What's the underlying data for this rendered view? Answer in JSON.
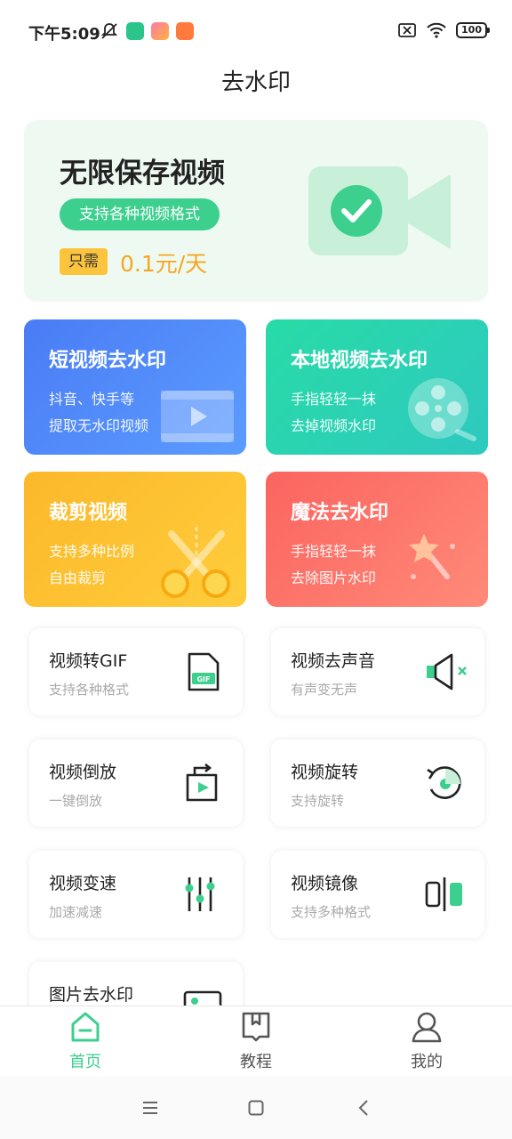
{
  "status_bar": {
    "time": "下午5:09",
    "battery": "100"
  },
  "page_title": "去水印",
  "promo": {
    "title": "无限保存视频",
    "tag": "支持各种视频格式",
    "badge": "只需",
    "price": "0.1元/天"
  },
  "feature_cards": [
    {
      "title": "短视频去水印",
      "line1": "抖音、快手等",
      "line2": "提取无水印视频"
    },
    {
      "title": "本地视频去水印",
      "line1": "手指轻轻一抹",
      "line2": "去掉视频水印"
    },
    {
      "title": "裁剪视频",
      "line1": "支持多种比例",
      "line2": "自由裁剪"
    },
    {
      "title": "魔法去水印",
      "line1": "手指轻轻一抹",
      "line2": "去除图片水印"
    }
  ],
  "tool_cards": [
    {
      "title": "视频转GIF",
      "subtitle": "支持各种格式",
      "icon": "gif-file-icon"
    },
    {
      "title": "视频去声音",
      "subtitle": "有声变无声",
      "icon": "mute-speaker-icon"
    },
    {
      "title": "视频倒放",
      "subtitle": "一键倒放",
      "icon": "reverse-play-icon"
    },
    {
      "title": "视频旋转",
      "subtitle": "支持旋转",
      "icon": "rotate-icon"
    },
    {
      "title": "视频变速",
      "subtitle": "加速减速",
      "icon": "speed-sliders-icon"
    },
    {
      "title": "视频镜像",
      "subtitle": "支持多种格式",
      "icon": "mirror-icon"
    },
    {
      "title": "图片去水印",
      "subtitle": "",
      "icon": "image-icon"
    }
  ],
  "gif_label": "GIF",
  "bottom_nav": {
    "home": "首页",
    "tutorial": "教程",
    "mine": "我的"
  },
  "colors": {
    "accent": "#3ccf8e",
    "promo_bg": "#eefaf1",
    "price": "#f5a623",
    "card_blue": "#4a7cf5",
    "card_teal": "#28dba6",
    "card_yellow": "#fbb82a",
    "card_red": "#fb6460"
  }
}
